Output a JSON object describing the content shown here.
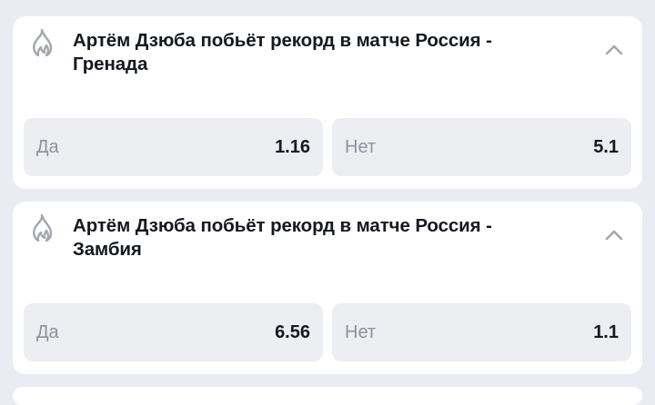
{
  "markets": [
    {
      "title": "Артём Дзюба побьёт рекорд в матче Россия - Гренада",
      "icon": "fire-icon",
      "toggle_icon": "chevron-up-icon",
      "options": [
        {
          "label": "Да",
          "odds": "1.16"
        },
        {
          "label": "Нет",
          "odds": "5.1"
        }
      ]
    },
    {
      "title": "Артём Дзюба побьёт рекорд в матче Россия - Замбия",
      "icon": "fire-icon",
      "toggle_icon": "chevron-up-icon",
      "options": [
        {
          "label": "Да",
          "odds": "6.56"
        },
        {
          "label": "Нет",
          "odds": "1.1"
        }
      ]
    }
  ],
  "colors": {
    "page_background": "#e9ecf2",
    "card_background": "#ffffff",
    "odds_button_background": "#eceef2",
    "title_text": "#141821",
    "muted_text": "#8e939c",
    "icon_gray": "#a3a7ae"
  }
}
